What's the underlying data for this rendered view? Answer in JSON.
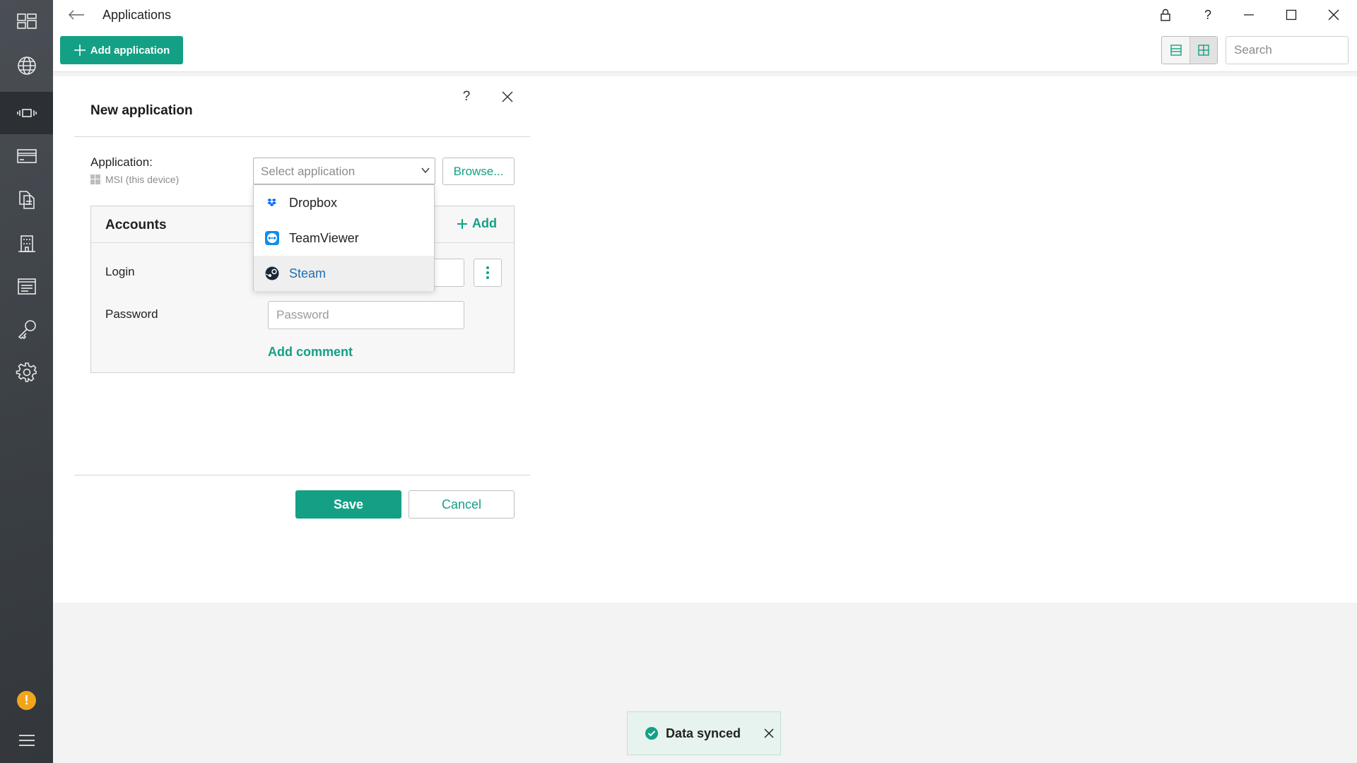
{
  "window": {
    "title": "Applications",
    "help_label": "?"
  },
  "toolbar": {
    "add_application_label": "Add application",
    "search_placeholder": "Search"
  },
  "sidebar": {
    "items": [
      {
        "name": "dashboard-icon"
      },
      {
        "name": "globe-icon"
      },
      {
        "name": "devices-icon"
      },
      {
        "name": "card-icon"
      },
      {
        "name": "documents-icon"
      },
      {
        "name": "building-icon"
      },
      {
        "name": "notes-icon"
      },
      {
        "name": "key-icon"
      },
      {
        "name": "gear-icon"
      }
    ],
    "warning_glyph": "!",
    "accent_color": "#f1a51c"
  },
  "dialog": {
    "title": "New application",
    "help_label": "?",
    "application_label": "Application:",
    "device_label": "MSI (this device)",
    "select_placeholder": "Select application",
    "browse_label": "Browse...",
    "accounts": {
      "title": "Accounts",
      "add_label": "Add",
      "login_label": "Login",
      "password_label": "Password",
      "password_placeholder": "Password",
      "add_comment_label": "Add comment"
    },
    "save_label": "Save",
    "cancel_label": "Cancel"
  },
  "dropdown": {
    "options": [
      {
        "label": "Dropbox",
        "icon": "dropbox-icon"
      },
      {
        "label": "TeamViewer",
        "icon": "teamviewer-icon"
      },
      {
        "label": "Steam",
        "icon": "steam-icon",
        "highlighted": true
      }
    ]
  },
  "toast": {
    "message": "Data synced"
  },
  "colors": {
    "accent": "#14a085",
    "sidebar": "#3f4449"
  }
}
